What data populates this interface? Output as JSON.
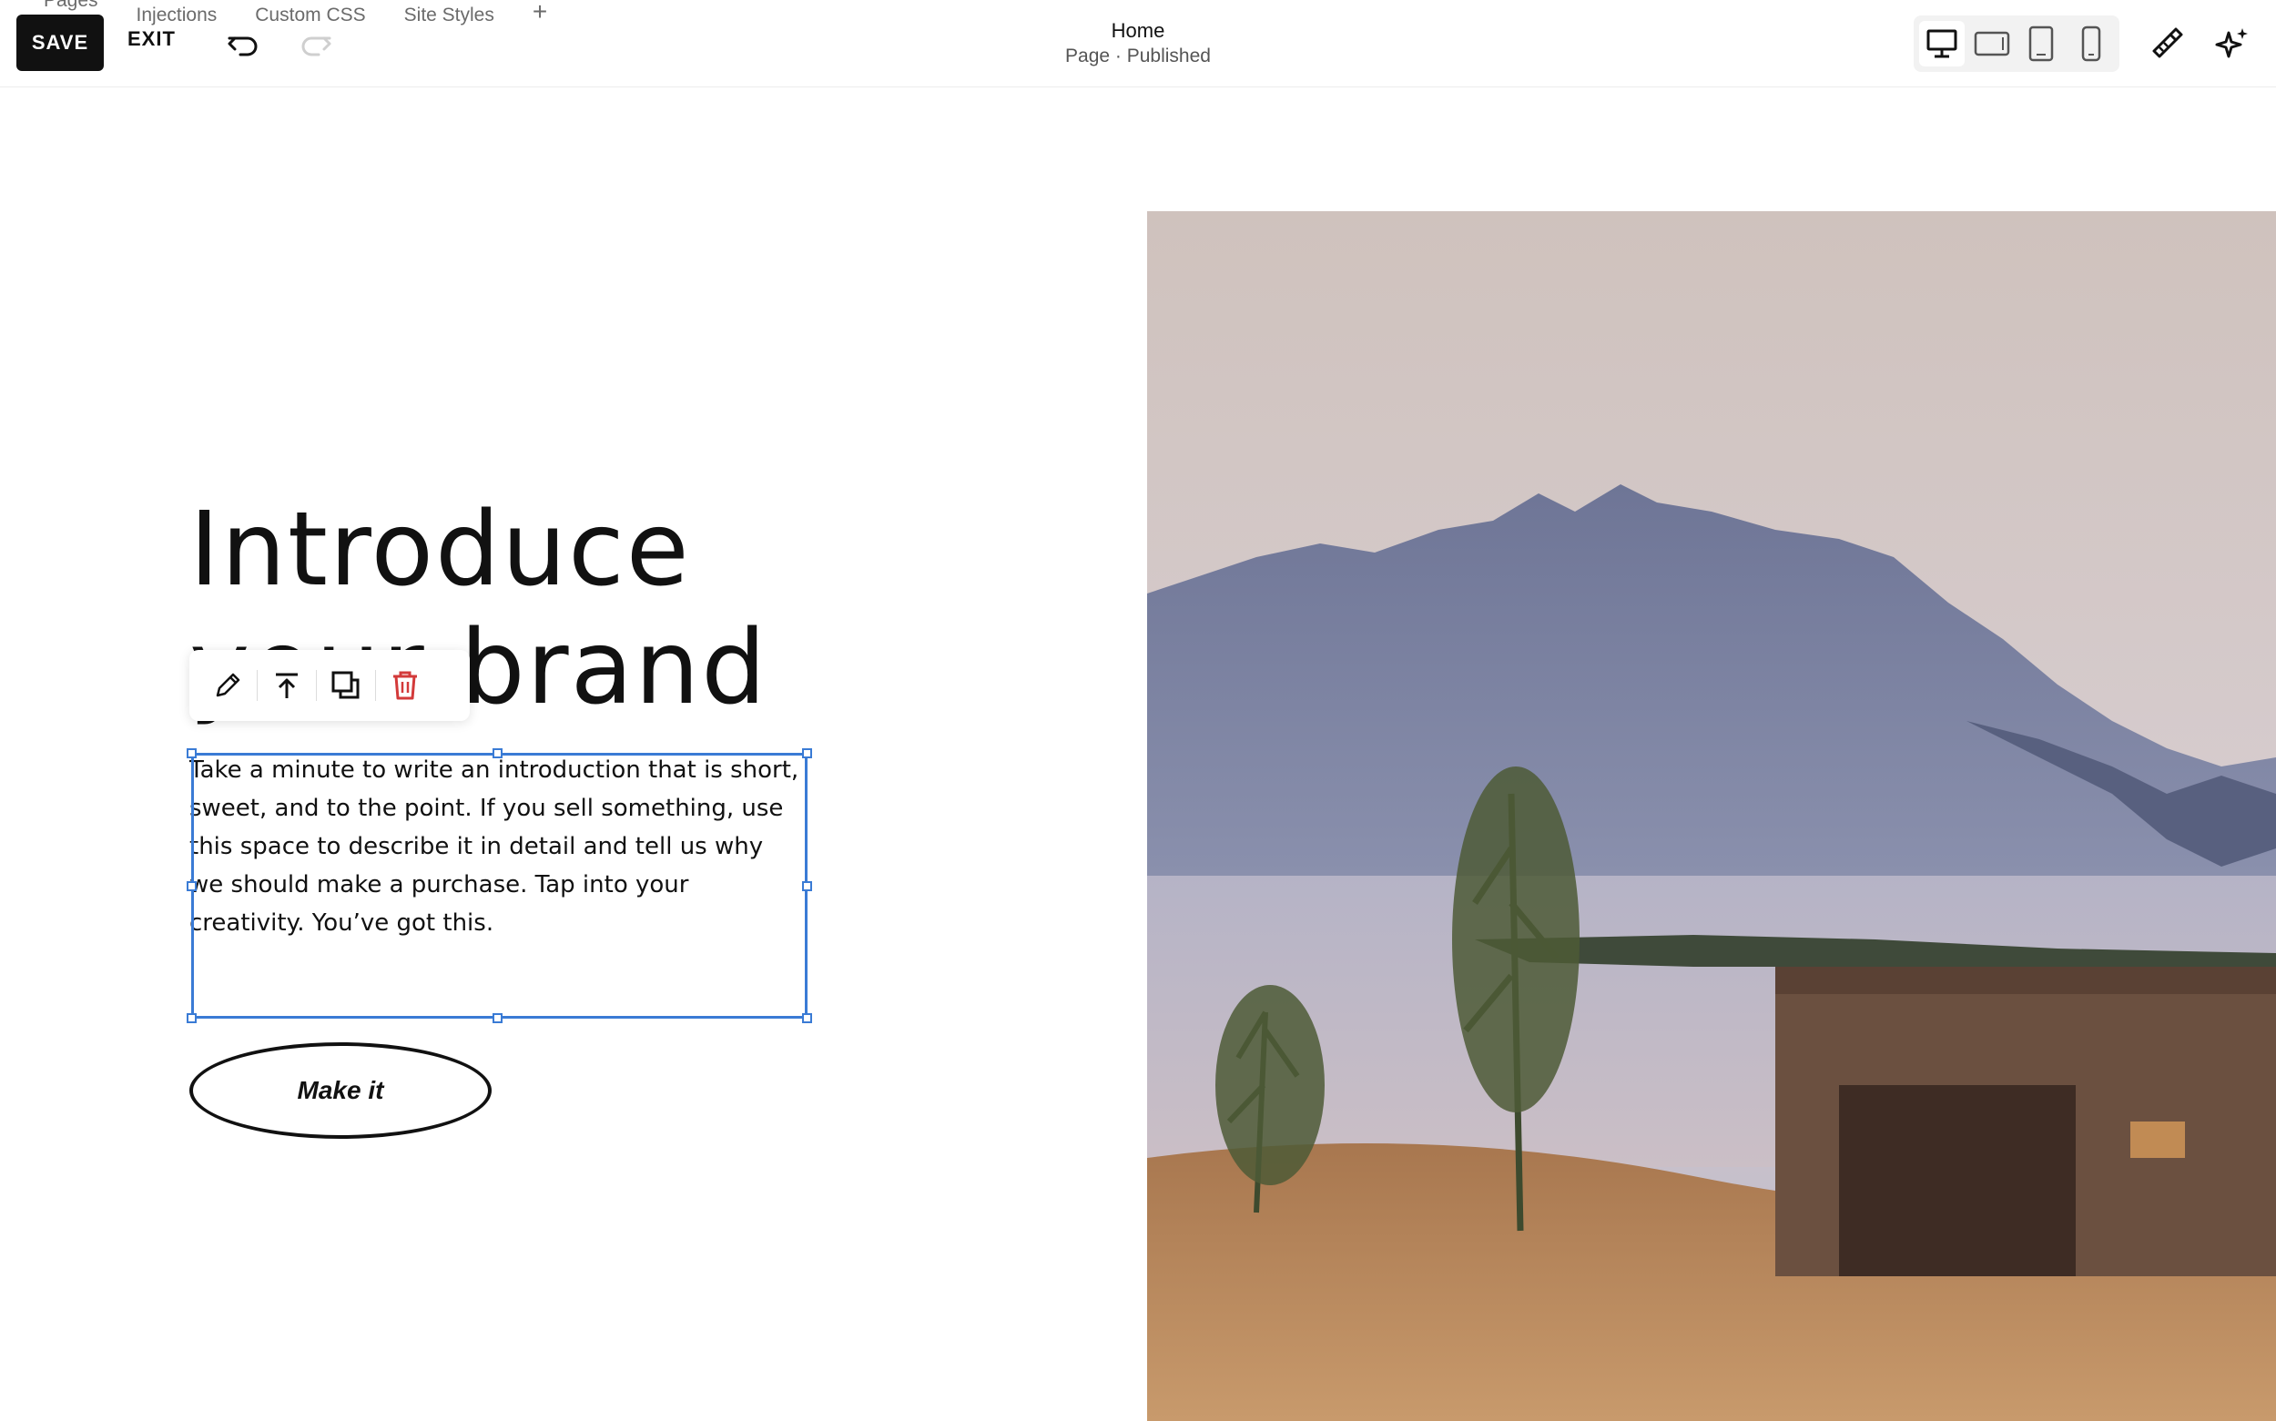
{
  "topbar": {
    "tabs": [
      {
        "label": "Pages"
      },
      {
        "label": "Injections"
      },
      {
        "label": "Custom CSS"
      },
      {
        "label": "Site Styles"
      }
    ],
    "add_tab_label": "+",
    "save_label": "SAVE",
    "exit_label": "EXIT",
    "page_title": "Home",
    "page_status": "Page · Published"
  },
  "device_views": [
    {
      "name": "desktop-view",
      "active": true
    },
    {
      "name": "tablet-landscape-view",
      "active": false
    },
    {
      "name": "tablet-portrait-view",
      "active": false
    },
    {
      "name": "mobile-view",
      "active": false
    }
  ],
  "icons": {
    "undo": "undo-icon",
    "redo": "redo-icon",
    "site_styles": "paint-brush-icon",
    "ai": "sparkle-icon",
    "edit": "pencil-icon",
    "move_to_top": "arrow-up-to-line-icon",
    "duplicate": "duplicate-icon",
    "delete": "trash-icon"
  },
  "colors": {
    "selection": "#3a7bd5",
    "delete": "#d33a3a",
    "primary": "#111111"
  },
  "content": {
    "headline_line1": "Introduce",
    "headline_line2": "your brand",
    "body": "Take a minute to write an introduction that is short, sweet, and to the point. If you sell something, use this space to describe it in detail and tell us why we should make a purchase. Tap into your creativity. You’ve got this.",
    "button_label": "Make it"
  }
}
